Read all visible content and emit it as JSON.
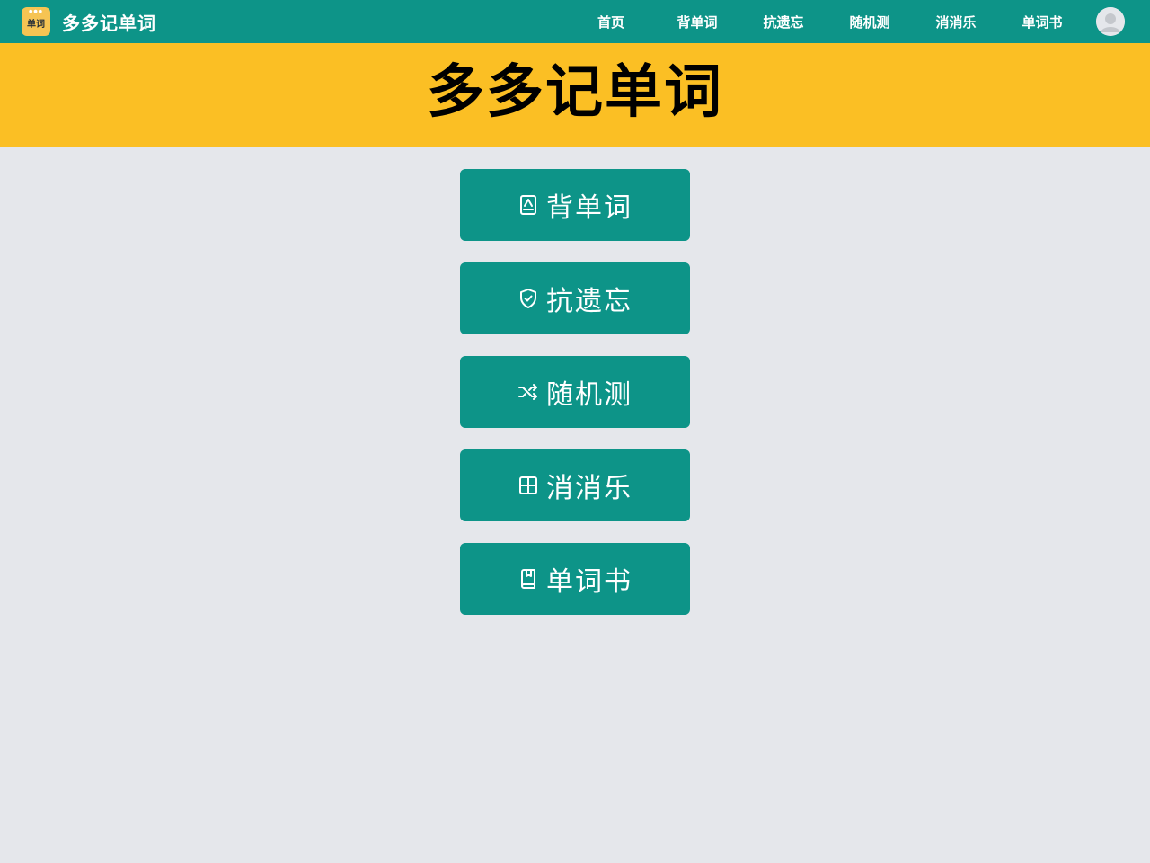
{
  "header": {
    "logo_text": "单词",
    "brand_name": "多多记单词",
    "nav": [
      {
        "label": "首页"
      },
      {
        "label": "背单词"
      },
      {
        "label": "抗遗忘"
      },
      {
        "label": "随机测"
      },
      {
        "label": "消消乐"
      },
      {
        "label": "单词书"
      }
    ],
    "avatar_icon": "user-avatar-icon"
  },
  "hero": {
    "title": "多多记单词"
  },
  "menu": [
    {
      "label": "背单词",
      "icon": "notebook-icon"
    },
    {
      "label": "抗遗忘",
      "icon": "shield-check-icon"
    },
    {
      "label": "随机测",
      "icon": "shuffle-icon"
    },
    {
      "label": "消消乐",
      "icon": "grid-icon"
    },
    {
      "label": "单词书",
      "icon": "book-icon"
    }
  ],
  "colors": {
    "primary": "#0d9488",
    "hero_background": "#fbbf24",
    "page_background": "#e5e7eb",
    "logo_background": "#f6c453"
  }
}
